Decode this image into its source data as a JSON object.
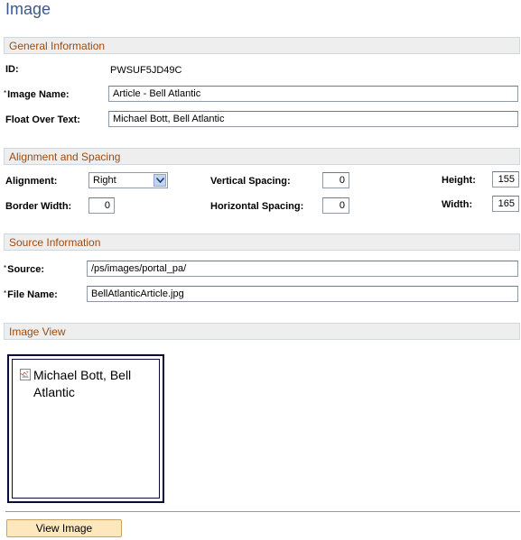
{
  "page": {
    "title": "Image"
  },
  "general": {
    "section_title": "General Information",
    "id_label": "ID:",
    "id_value": "PWSUF5JD49C",
    "image_name_label": "Image Name:",
    "image_name_value": "Article - Bell Atlantic",
    "float_over_label": "Float Over Text:",
    "float_over_value": "Michael Bott, Bell Atlantic",
    "required_mark": "*"
  },
  "alignment": {
    "section_title": "Alignment and Spacing",
    "alignment_label": "Alignment:",
    "alignment_value": "Right",
    "border_width_label": "Border Width:",
    "border_width_value": "0",
    "vertical_spacing_label": "Vertical Spacing:",
    "vertical_spacing_value": "0",
    "horizontal_spacing_label": "Horizontal Spacing:",
    "horizontal_spacing_value": "0",
    "height_label": "Height:",
    "height_value": "155",
    "width_label": "Width:",
    "width_value": "165"
  },
  "source": {
    "section_title": "Source Information",
    "source_label": "Source:",
    "source_value": "/ps/images/portal_pa/",
    "file_name_label": "File Name:",
    "file_name_value": "BellAtlanticArticle.jpg"
  },
  "image_view": {
    "section_title": "Image View",
    "alt_text": "Michael Bott, Bell Atlantic",
    "broken_icon": "broken-image-icon"
  },
  "actions": {
    "view_image_label": "View Image"
  },
  "colors": {
    "title": "#3a5a8c",
    "section_text": "#a24a0b",
    "section_bg": "#eeeeee",
    "button_bg": "#fde8be"
  }
}
